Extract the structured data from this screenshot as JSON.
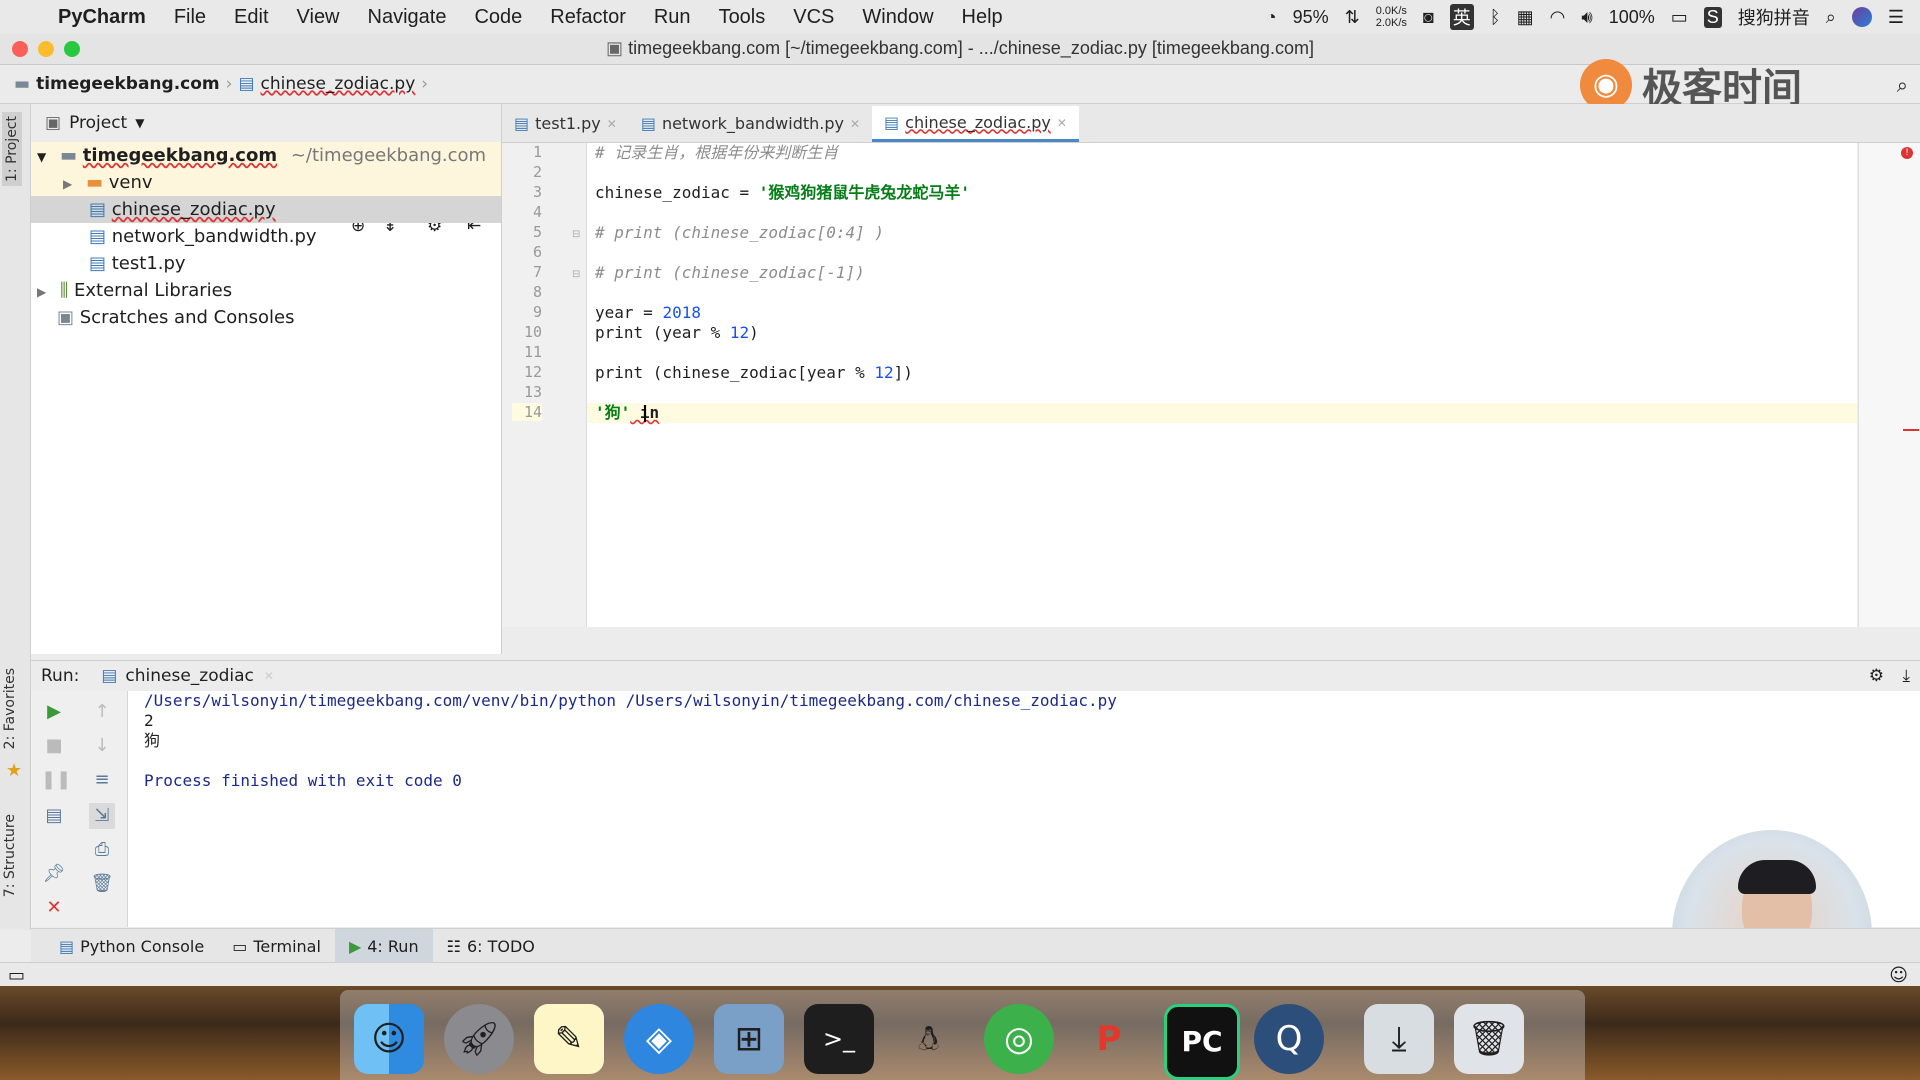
{
  "menubar": {
    "app_name": "PyCharm",
    "items": [
      "File",
      "Edit",
      "View",
      "Navigate",
      "Code",
      "Refactor",
      "Run",
      "Tools",
      "VCS",
      "Window",
      "Help"
    ],
    "status": {
      "cpu": "95%",
      "net_up": "0.0K/s",
      "net_down": "2.0K/s",
      "input_lang": "英",
      "battery": "100%",
      "ime": "搜狗拼音"
    }
  },
  "window": {
    "title": "timegeekbang.com [~/timegeekbang.com] - .../chinese_zodiac.py [timegeekbang.com]"
  },
  "breadcrumb": {
    "project": "timegeekbang.com",
    "file": "chinese_zodiac.py"
  },
  "project_panel": {
    "header": "Project",
    "root_name": "timegeekbang.com",
    "root_path": "~/timegeekbang.com",
    "items": [
      "venv",
      "chinese_zodiac.py",
      "network_bandwidth.py",
      "test1.py",
      "External Libraries",
      "Scratches and Consoles"
    ]
  },
  "side_tabs": {
    "project": "1: Project",
    "favorites": "2: Favorites",
    "structure": "7: Structure"
  },
  "editor": {
    "tabs": [
      "test1.py",
      "network_bandwidth.py",
      "chinese_zodiac.py"
    ],
    "active_tab": "chinese_zodiac.py",
    "line_numbers": [
      "1",
      "2",
      "3",
      "4",
      "5",
      "6",
      "7",
      "8",
      "9",
      "10",
      "11",
      "12",
      "13",
      "14"
    ],
    "code": {
      "l1": "# 记录生肖，根据年份来判断生肖",
      "l3_a": "chinese_zodiac = ",
      "l3_b": "'猴鸡狗猪鼠牛虎兔龙蛇马羊'",
      "l5": "# print (chinese_zodiac[0:4] )",
      "l7": "# print (chinese_zodiac[-1])",
      "l9_a": "year = ",
      "l9_b": "2018",
      "l10_a": "print (year % ",
      "l10_b": "12",
      "l10_c": ")",
      "l12_a": "print (chinese_zodiac[year % ",
      "l12_b": "12",
      "l12_c": "])",
      "l14_a": "'狗'",
      "l14_b": " in"
    }
  },
  "run_panel": {
    "label": "Run:",
    "config": "chinese_zodiac",
    "output": [
      "/Users/wilsonyin/timegeekbang.com/venv/bin/python /Users/wilsonyin/timegeekbang.com/chinese_zodiac.py",
      "2",
      "狗",
      "",
      "Process finished with exit code 0"
    ]
  },
  "bottom_tabs": [
    "Python Console",
    "Terminal",
    "4: Run",
    "6: TODO"
  ],
  "watermark": {
    "brand": "极客时间"
  },
  "colors": {
    "accent": "#4a88c7",
    "string": "#067d17",
    "number": "#1750eb",
    "comment": "#8c8c8c",
    "console_text": "#1b2a8a"
  }
}
